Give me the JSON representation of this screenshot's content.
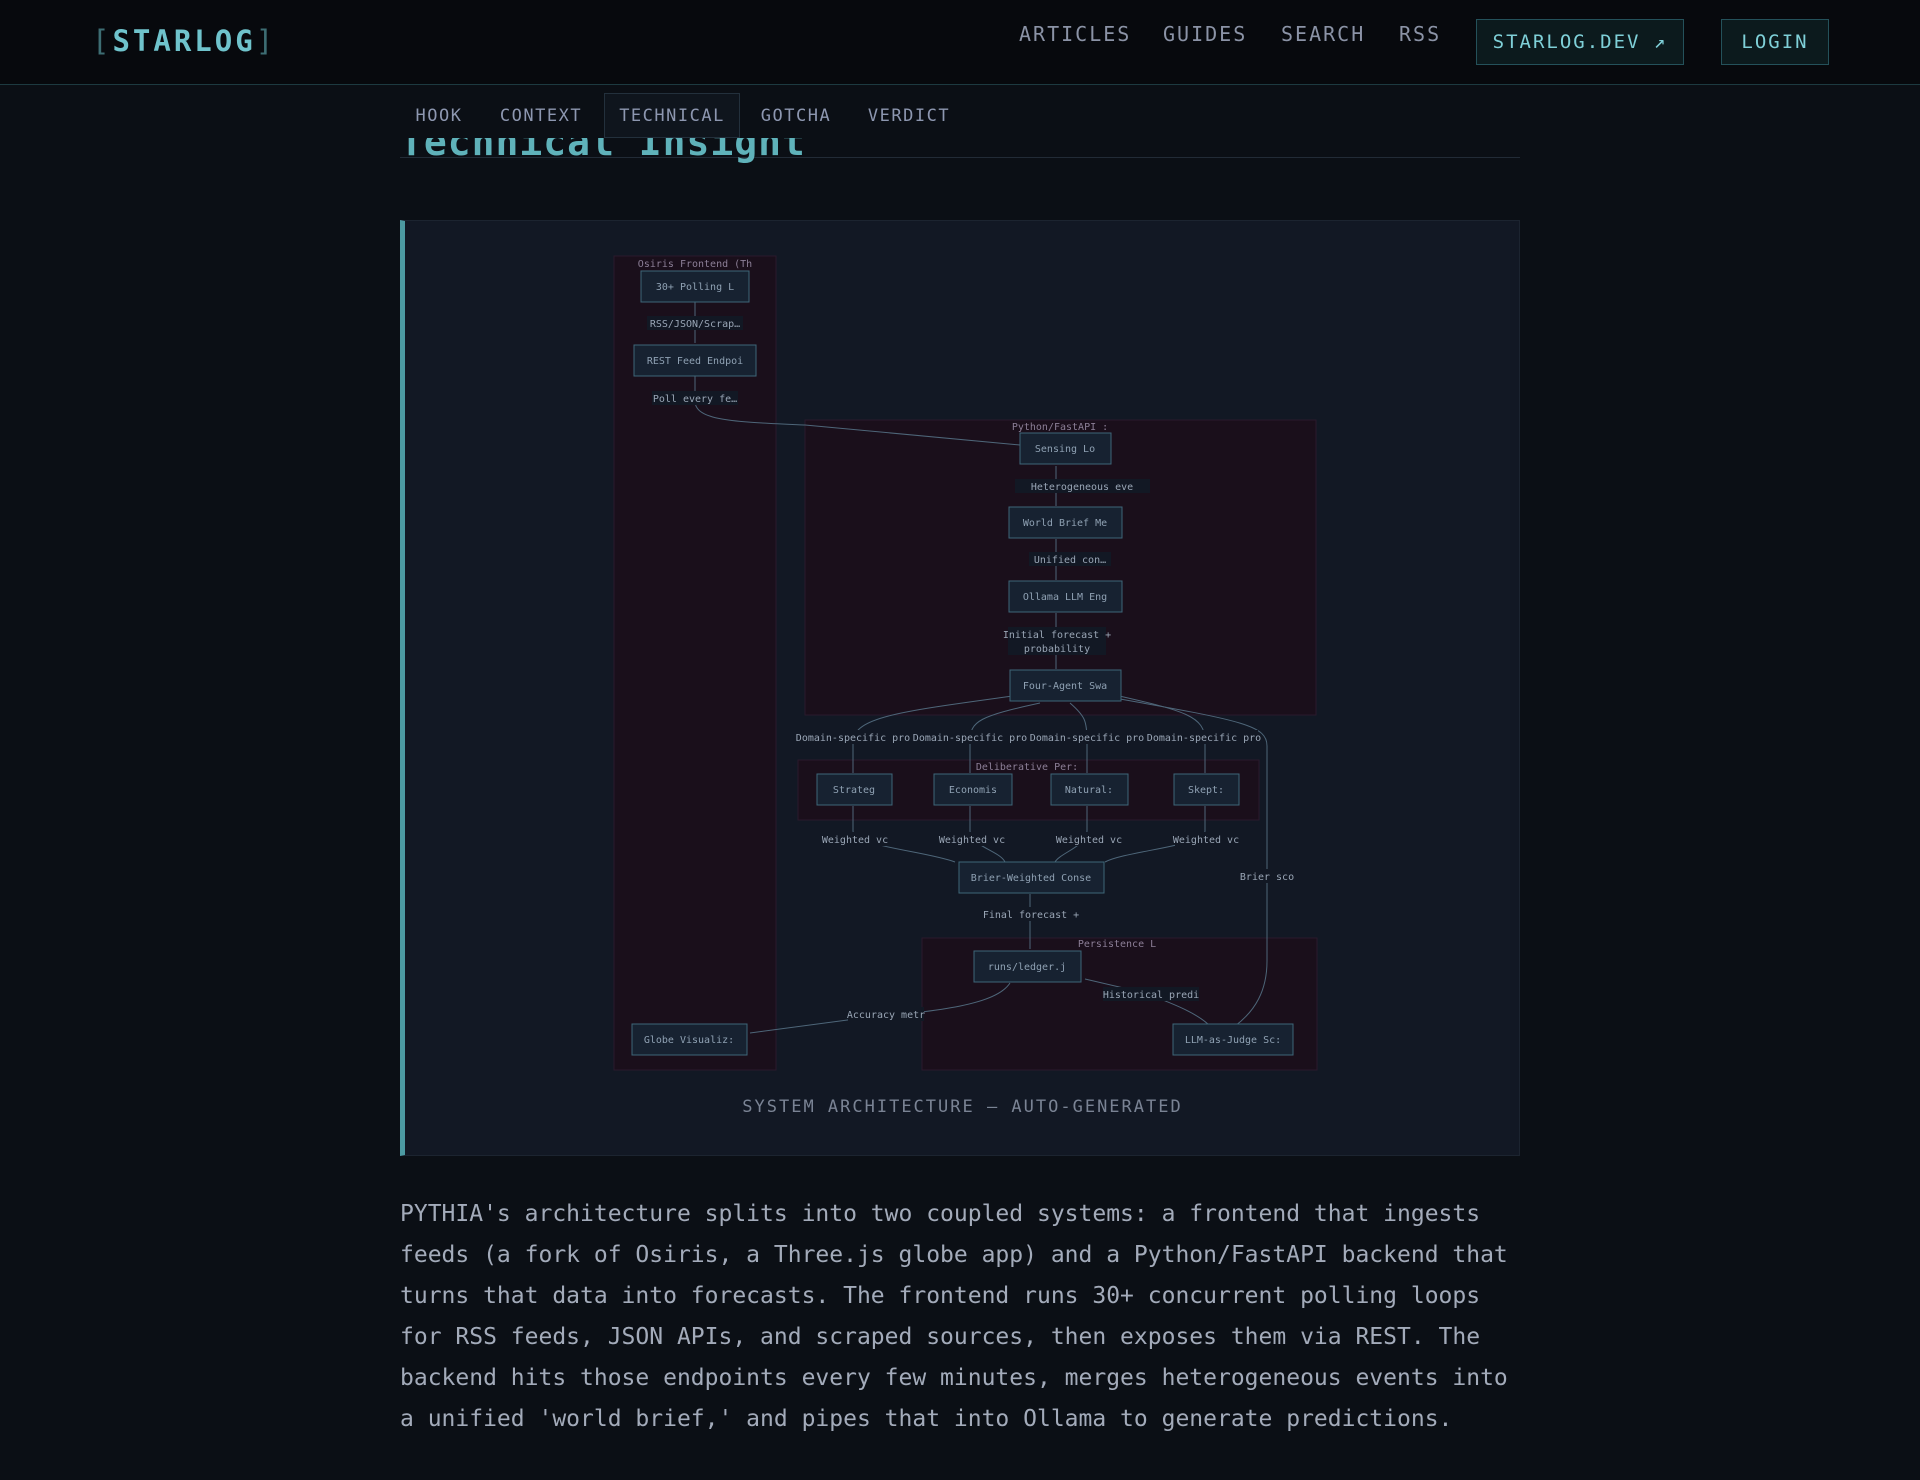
{
  "brand": {
    "open": "[",
    "name": "STARLOG",
    "close": "]"
  },
  "nav": {
    "links": [
      "ARTICLES",
      "GUIDES",
      "SEARCH",
      "RSS"
    ],
    "site_button": "STARLOG.DEV ↗",
    "login_button": "LOGIN"
  },
  "tabs": [
    "HOOK",
    "CONTEXT",
    "TECHNICAL",
    "GOTCHA",
    "VERDICT"
  ],
  "active_tab": "TECHNICAL",
  "section_heading": "Technical Insight",
  "diagram": {
    "clusters": {
      "frontend": "Osiris Frontend (Th",
      "backend": "Python/FastAPI :",
      "agents": "Deliberative Per:",
      "persistence": "Persistence L"
    },
    "nodes": {
      "polling": "30+ Polling L",
      "rest": "REST Feed Endpoi",
      "globe": "Globe Visualiz:",
      "sensing": "Sensing Lo",
      "world_brief": "World Brief Me",
      "ollama": "Ollama LLM Eng",
      "swarm": "Four-Agent Swa",
      "strategist": "Strateg",
      "economist": "Economis",
      "natural": "Natural:",
      "skeptic": "Skept:",
      "consensus": "Brier-Weighted Conse",
      "ledger": "runs/ledger.j",
      "judge": "LLM-as-Judge Sc:"
    },
    "edge_labels": {
      "rss_json": "RSS/JSON/Scrap…",
      "poll": "Poll every fe…",
      "hetero": "Heterogeneous eve",
      "unified": "Unified con…",
      "initial_1": "Initial forecast +",
      "initial_2": "probability",
      "domain": "Domain-specific pro",
      "weighted": "Weighted vc",
      "brier": "Brier sco",
      "final": "Final forecast +",
      "historical": "Historical predi",
      "accuracy": "Accuracy metr"
    }
  },
  "caption": "SYSTEM ARCHITECTURE — AUTO-GENERATED",
  "body_text": "PYTHIA's architecture splits into two coupled systems: a frontend that ingests feeds (a fork of Osiris, a Three.js globe app) and a Python/FastAPI backend that turns that data into forecasts. The frontend runs 30+ concurrent polling loops for RSS feeds, JSON APIs, and scraped sources, then exposes them via REST. The backend hits those endpoints every few minutes, merges heterogeneous events into a unified 'world brief,' and pipes that into Ollama to generate predictions."
}
